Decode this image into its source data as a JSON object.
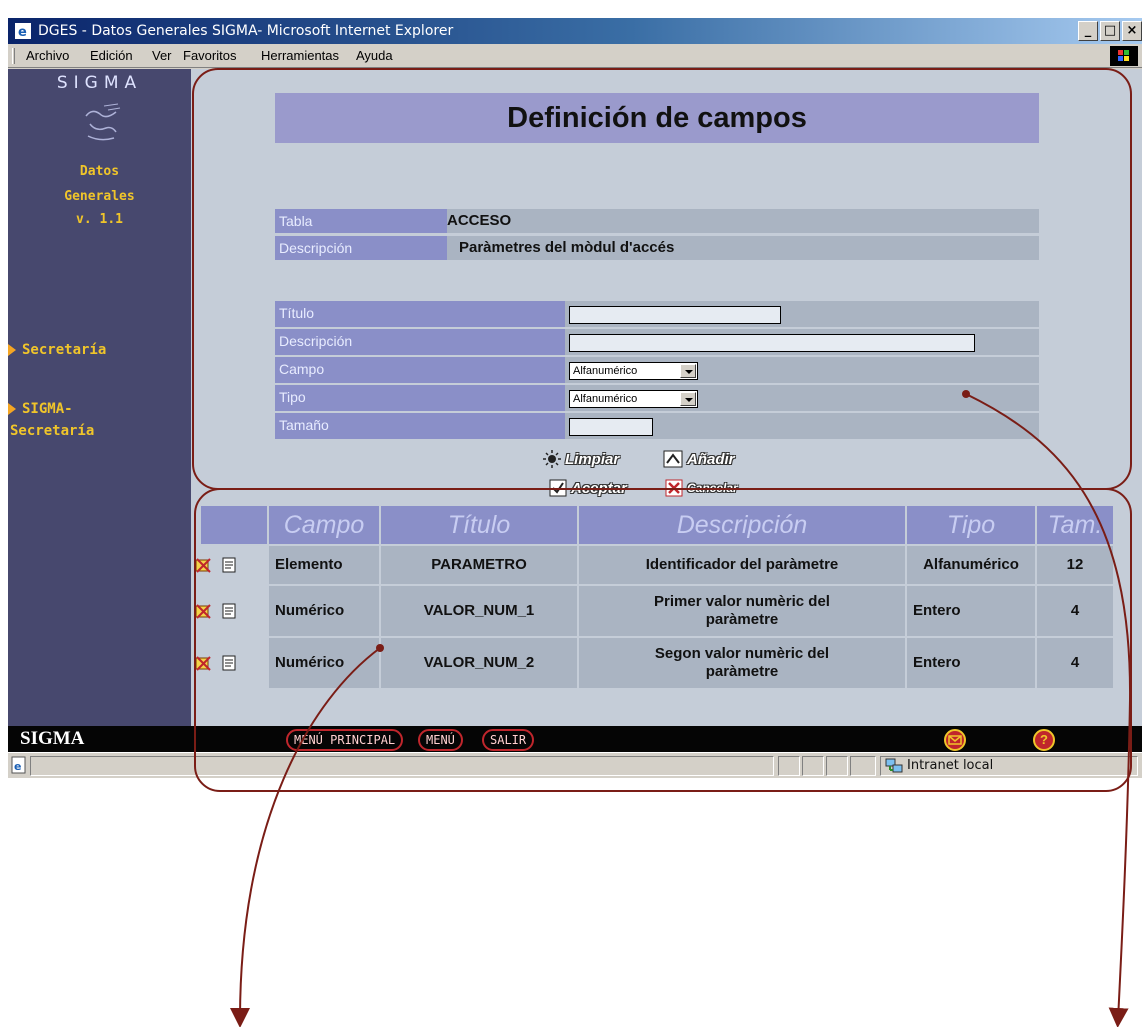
{
  "window": {
    "title": "DGES - Datos Generales SIGMA- Microsoft Internet Explorer",
    "buttons": [
      "_",
      "□",
      "×"
    ]
  },
  "menubar": [
    "Archivo",
    "Edición",
    "Ver",
    "Favoritos",
    "Herramientas",
    "Ayuda"
  ],
  "sidebar": {
    "brand": "SIGMA",
    "app_lines": [
      "Datos",
      "Generales",
      "v. 1.1"
    ],
    "links": [
      "Secretaría",
      "SIGMA-",
      "Secretaría"
    ]
  },
  "page": {
    "title": "Definición de campos",
    "info": [
      {
        "label": "Tabla",
        "value": "ACCESO"
      },
      {
        "label": "Descripción",
        "value": "Paràmetres del mòdul d'accés"
      }
    ],
    "form": {
      "titulo_label": "Título",
      "descripcion_label": "Descripción",
      "campo_label": "Campo",
      "campo_value": "Alfanumérico",
      "tipo_label": "Tipo",
      "tipo_value": "Alfanumérico",
      "tamano_label": "Tamaño"
    },
    "actions": {
      "limpiar": "Limpiar",
      "anadir": "Añadir",
      "aceptar": "Aceptar",
      "cancelar": "Cancelar"
    }
  },
  "table": {
    "headers": [
      "Campo",
      "Título",
      "Descripción",
      "Tipo",
      "Tam."
    ],
    "rows": [
      {
        "campo": "Elemento",
        "titulo": "PARAMETRO",
        "descripcion": "Identificador del paràmetre",
        "tipo": "Alfanumérico",
        "tam": "12"
      },
      {
        "campo": "Numérico",
        "titulo": "VALOR_NUM_1",
        "descripcion": "Primer valor numèric del paràmetre",
        "tipo": "Entero",
        "tam": "4"
      },
      {
        "campo": "Numérico",
        "titulo": "VALOR_NUM_2",
        "descripcion": "Segon valor numèric del paràmetre",
        "tipo": "Entero",
        "tam": "4"
      }
    ]
  },
  "bottombar": {
    "brand": "SIGMA",
    "menu_principal": "MENÚ PRINCIPAL",
    "menu": "MENÚ",
    "salir": "SALIR",
    "help": "?"
  },
  "statusbar": {
    "zone": "Intranet local"
  },
  "colors": {
    "sidebar": "#47486e",
    "accent_yellow": "#f0c52a",
    "header_purple": "#8a8fc8",
    "title_purple": "#9a9acc",
    "annotation": "#7a1d16"
  }
}
